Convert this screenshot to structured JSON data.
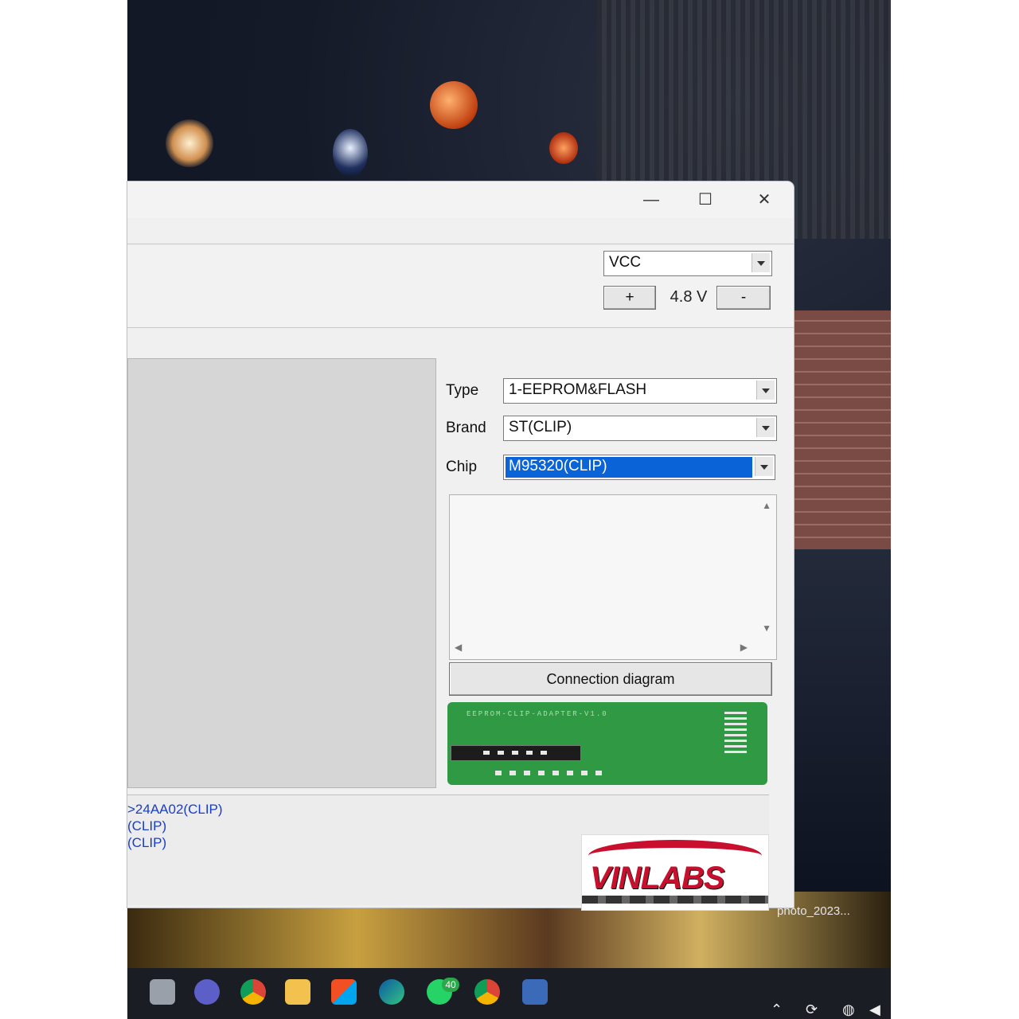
{
  "window": {
    "controls": {
      "minimize": "—",
      "maximize": "☐",
      "close": "✕"
    }
  },
  "power": {
    "supply_selected": "VCC",
    "increase_label": "+",
    "voltage_value": "4.8 V",
    "decrease_label": "-"
  },
  "selector": {
    "type_label": "Type",
    "type_value": "1-EEPROM&FLASH",
    "brand_label": "Brand",
    "brand_value": "ST(CLIP)",
    "chip_label": "Chip",
    "chip_value": "M95320(CLIP)"
  },
  "diagram": {
    "button_label": "Connection diagram",
    "board_caption": "EEPROM-CLIP-ADAPTER-V1.0"
  },
  "log": {
    "lines": [
      ">24AA02(CLIP)",
      "(CLIP)",
      "(CLIP)"
    ]
  },
  "watermark": {
    "brand": "VINLABS"
  },
  "desktop": {
    "file_caption": "photo_2023...",
    "chat_badge": "40"
  },
  "colors": {
    "selection_blue": "#0a64d8",
    "log_blue": "#1a3dc8",
    "board_green": "#2f9a43",
    "logo_red": "#c8102e"
  }
}
